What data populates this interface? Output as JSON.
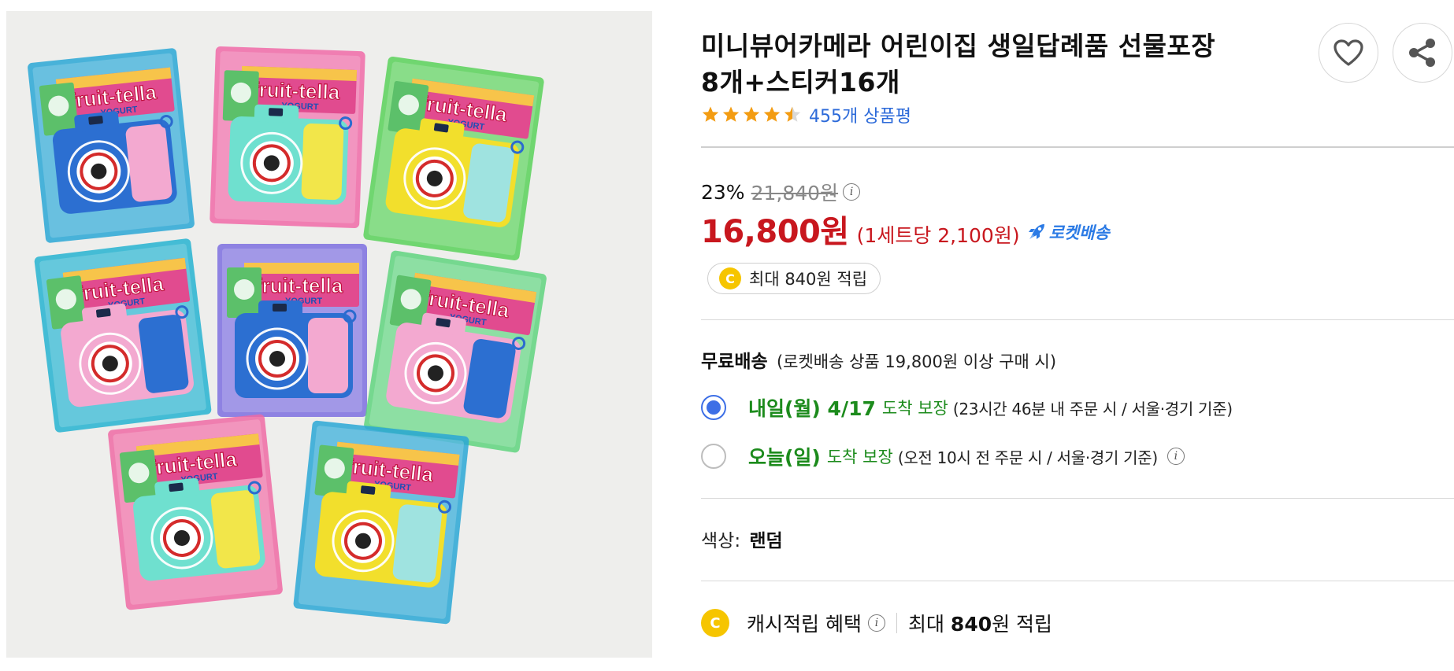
{
  "product": {
    "title_line1": "미니뷰어카메라 어린이집 생일답례품 선물포장",
    "title_line2": "8개+스티커16개",
    "rating": 4.5,
    "review_count_text": "455개 상품평"
  },
  "actions": {
    "wishlist_icon": "heart-icon",
    "share_icon": "share-icon"
  },
  "price": {
    "discount_rate": "23%",
    "original_price": "21,840원",
    "sale_price": "16,800원",
    "unit_price": "(1세트당 2,100원)",
    "rocket_label": "로켓배송"
  },
  "cashback_pill": {
    "coin": "C",
    "text": "최대 840원 적립"
  },
  "shipping": {
    "free_label": "무료배송",
    "condition": "(로켓배송 상품 19,800원 이상 구매 시)",
    "options": [
      {
        "day": "내일(월) 4/17",
        "guarantee": "도착 보장",
        "detail": "(23시간 46분 내 주문 시 / 서울·경기 기준)",
        "selected": true
      },
      {
        "day": "오늘(일)",
        "guarantee": "도착 보장",
        "detail": "(오전 10시 전 주문 시 / 서울·경기 기준)",
        "selected": false
      }
    ]
  },
  "color_option": {
    "label": "색상:",
    "value": "랜덤"
  },
  "cash_benefit": {
    "coin": "C",
    "label": "캐시적립 혜택",
    "max_prefix": "최대",
    "max_amount": "840",
    "max_suffix": "원 적립"
  },
  "image_text": {
    "candy_brand": "fruit-tella",
    "candy_flavor": "YOGURT"
  },
  "colors": {
    "price_red": "#c8171e",
    "link_blue": "#2c6ad9",
    "delivery_green": "#1c8b1c",
    "radio_blue": "#3d6fe6",
    "star_orange": "#f39c12",
    "coin_yellow": "#f6c500"
  }
}
